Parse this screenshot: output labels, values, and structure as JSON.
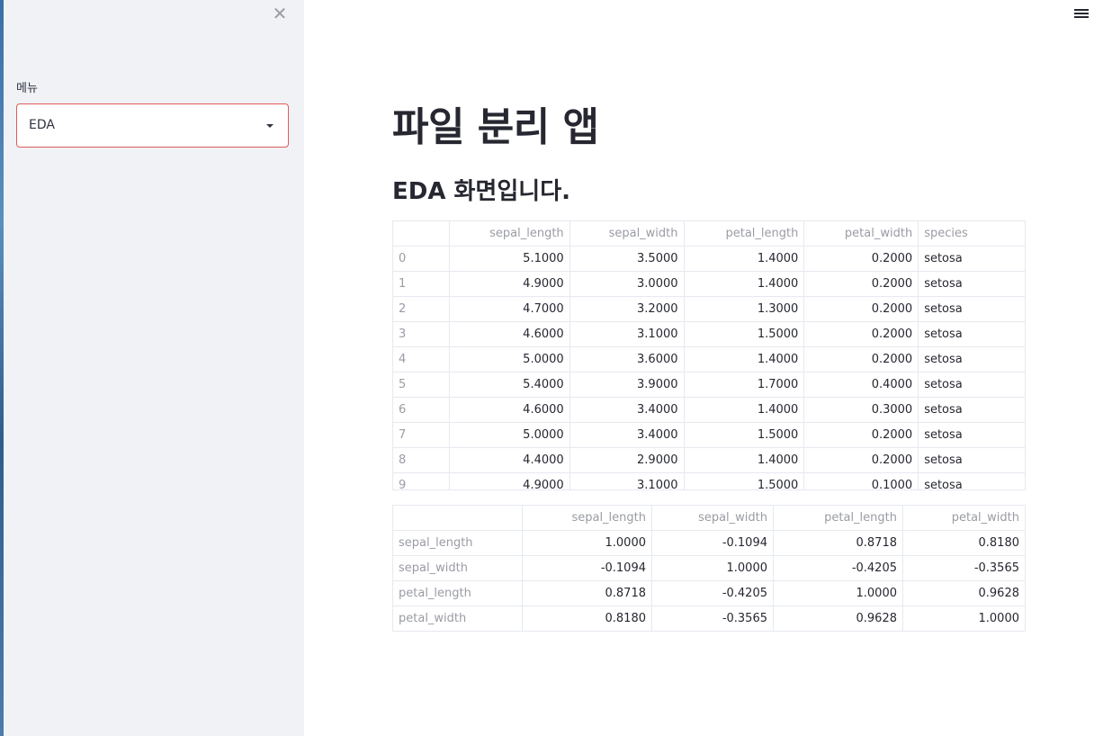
{
  "sidebar": {
    "close_glyph": "✕",
    "menu_label": "메뉴",
    "select_value": "EDA"
  },
  "main": {
    "title": "파일 분리 앱",
    "subtitle": "EDA 화면입니다."
  },
  "dataframe": {
    "columns": [
      "",
      "sepal_length",
      "sepal_width",
      "petal_length",
      "petal_width",
      "species"
    ],
    "rows": [
      [
        "0",
        "5.1000",
        "3.5000",
        "1.4000",
        "0.2000",
        "setosa"
      ],
      [
        "1",
        "4.9000",
        "3.0000",
        "1.4000",
        "0.2000",
        "setosa"
      ],
      [
        "2",
        "4.7000",
        "3.2000",
        "1.3000",
        "0.2000",
        "setosa"
      ],
      [
        "3",
        "4.6000",
        "3.1000",
        "1.5000",
        "0.2000",
        "setosa"
      ],
      [
        "4",
        "5.0000",
        "3.6000",
        "1.4000",
        "0.2000",
        "setosa"
      ],
      [
        "5",
        "5.4000",
        "3.9000",
        "1.7000",
        "0.4000",
        "setosa"
      ],
      [
        "6",
        "4.6000",
        "3.4000",
        "1.4000",
        "0.3000",
        "setosa"
      ],
      [
        "7",
        "5.0000",
        "3.4000",
        "1.5000",
        "0.2000",
        "setosa"
      ],
      [
        "8",
        "4.4000",
        "2.9000",
        "1.4000",
        "0.2000",
        "setosa"
      ],
      [
        "9",
        "4.9000",
        "3.1000",
        "1.5000",
        "0.1000",
        "setosa"
      ]
    ]
  },
  "correlation": {
    "columns": [
      "",
      "sepal_length",
      "sepal_width",
      "petal_length",
      "petal_width"
    ],
    "rows": [
      [
        "sepal_length",
        "1.0000",
        "-0.1094",
        "0.8718",
        "0.8180"
      ],
      [
        "sepal_width",
        "-0.1094",
        "1.0000",
        "-0.4205",
        "-0.3565"
      ],
      [
        "petal_length",
        "0.8718",
        "-0.4205",
        "1.0000",
        "0.9628"
      ],
      [
        "petal_width",
        "0.8180",
        "-0.3565",
        "0.9628",
        "1.0000"
      ]
    ]
  },
  "colors": {
    "sidebar_bg": "#f0f2f6",
    "select_border": "#e25b58",
    "text": "#262730",
    "muted": "#9a9ca4",
    "grid": "#e6e9ef"
  }
}
